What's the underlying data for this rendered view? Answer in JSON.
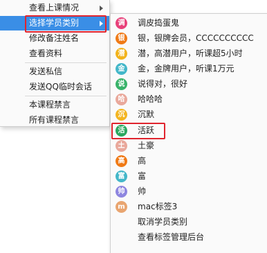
{
  "menu1": {
    "items": [
      {
        "label": "查看上课情况",
        "has_submenu": true
      },
      {
        "label": "选择学员类别",
        "has_submenu": true,
        "selected": true
      },
      {
        "label": "修改备注姓名"
      },
      {
        "label": "查看资料"
      },
      {
        "label": "发送私信"
      },
      {
        "label": "发送QQ临时会话"
      },
      {
        "label": "本课程禁言"
      },
      {
        "label": "所有课程禁言"
      }
    ]
  },
  "menu2": {
    "items": [
      {
        "icon_text": "调",
        "icon_color": "#e8417a",
        "label": "调皮捣蛋鬼"
      },
      {
        "icon_text": "银",
        "icon_color": "#f07a16",
        "label": "银，银牌会员，CCCCCCCCCC"
      },
      {
        "icon_text": "潜",
        "icon_color": "#f2b31c",
        "label": "潜，高潜用户，听课超5小时"
      },
      {
        "icon_text": "金",
        "icon_color": "#43b7c9",
        "label": "金，金牌用户，听课1万元"
      },
      {
        "icon_text": "说",
        "icon_color": "#39b36a",
        "label": "说得对，很好"
      },
      {
        "icon_text": "哈",
        "icon_color": "#e9a89b",
        "label": "哈哈哈"
      },
      {
        "icon_text": "沉",
        "icon_color": "#f3b521",
        "label": "沉默"
      },
      {
        "icon_text": "活",
        "icon_color": "#2aa85f",
        "label": "活跃",
        "highlight": true
      },
      {
        "icon_text": "土",
        "icon_color": "#e9a89b",
        "label": "土豪"
      },
      {
        "icon_text": "高",
        "icon_color": "#f07a16",
        "label": "高"
      },
      {
        "icon_text": "富",
        "icon_color": "#43b7c9",
        "label": "富"
      },
      {
        "icon_text": "帅",
        "icon_color": "#8e86e0",
        "label": "帅"
      },
      {
        "icon_text": "m",
        "icon_color": "#e9a570",
        "label": "mac标签3"
      },
      {
        "label": "取消学员类别"
      },
      {
        "label": "查看标签管理后台"
      }
    ]
  }
}
